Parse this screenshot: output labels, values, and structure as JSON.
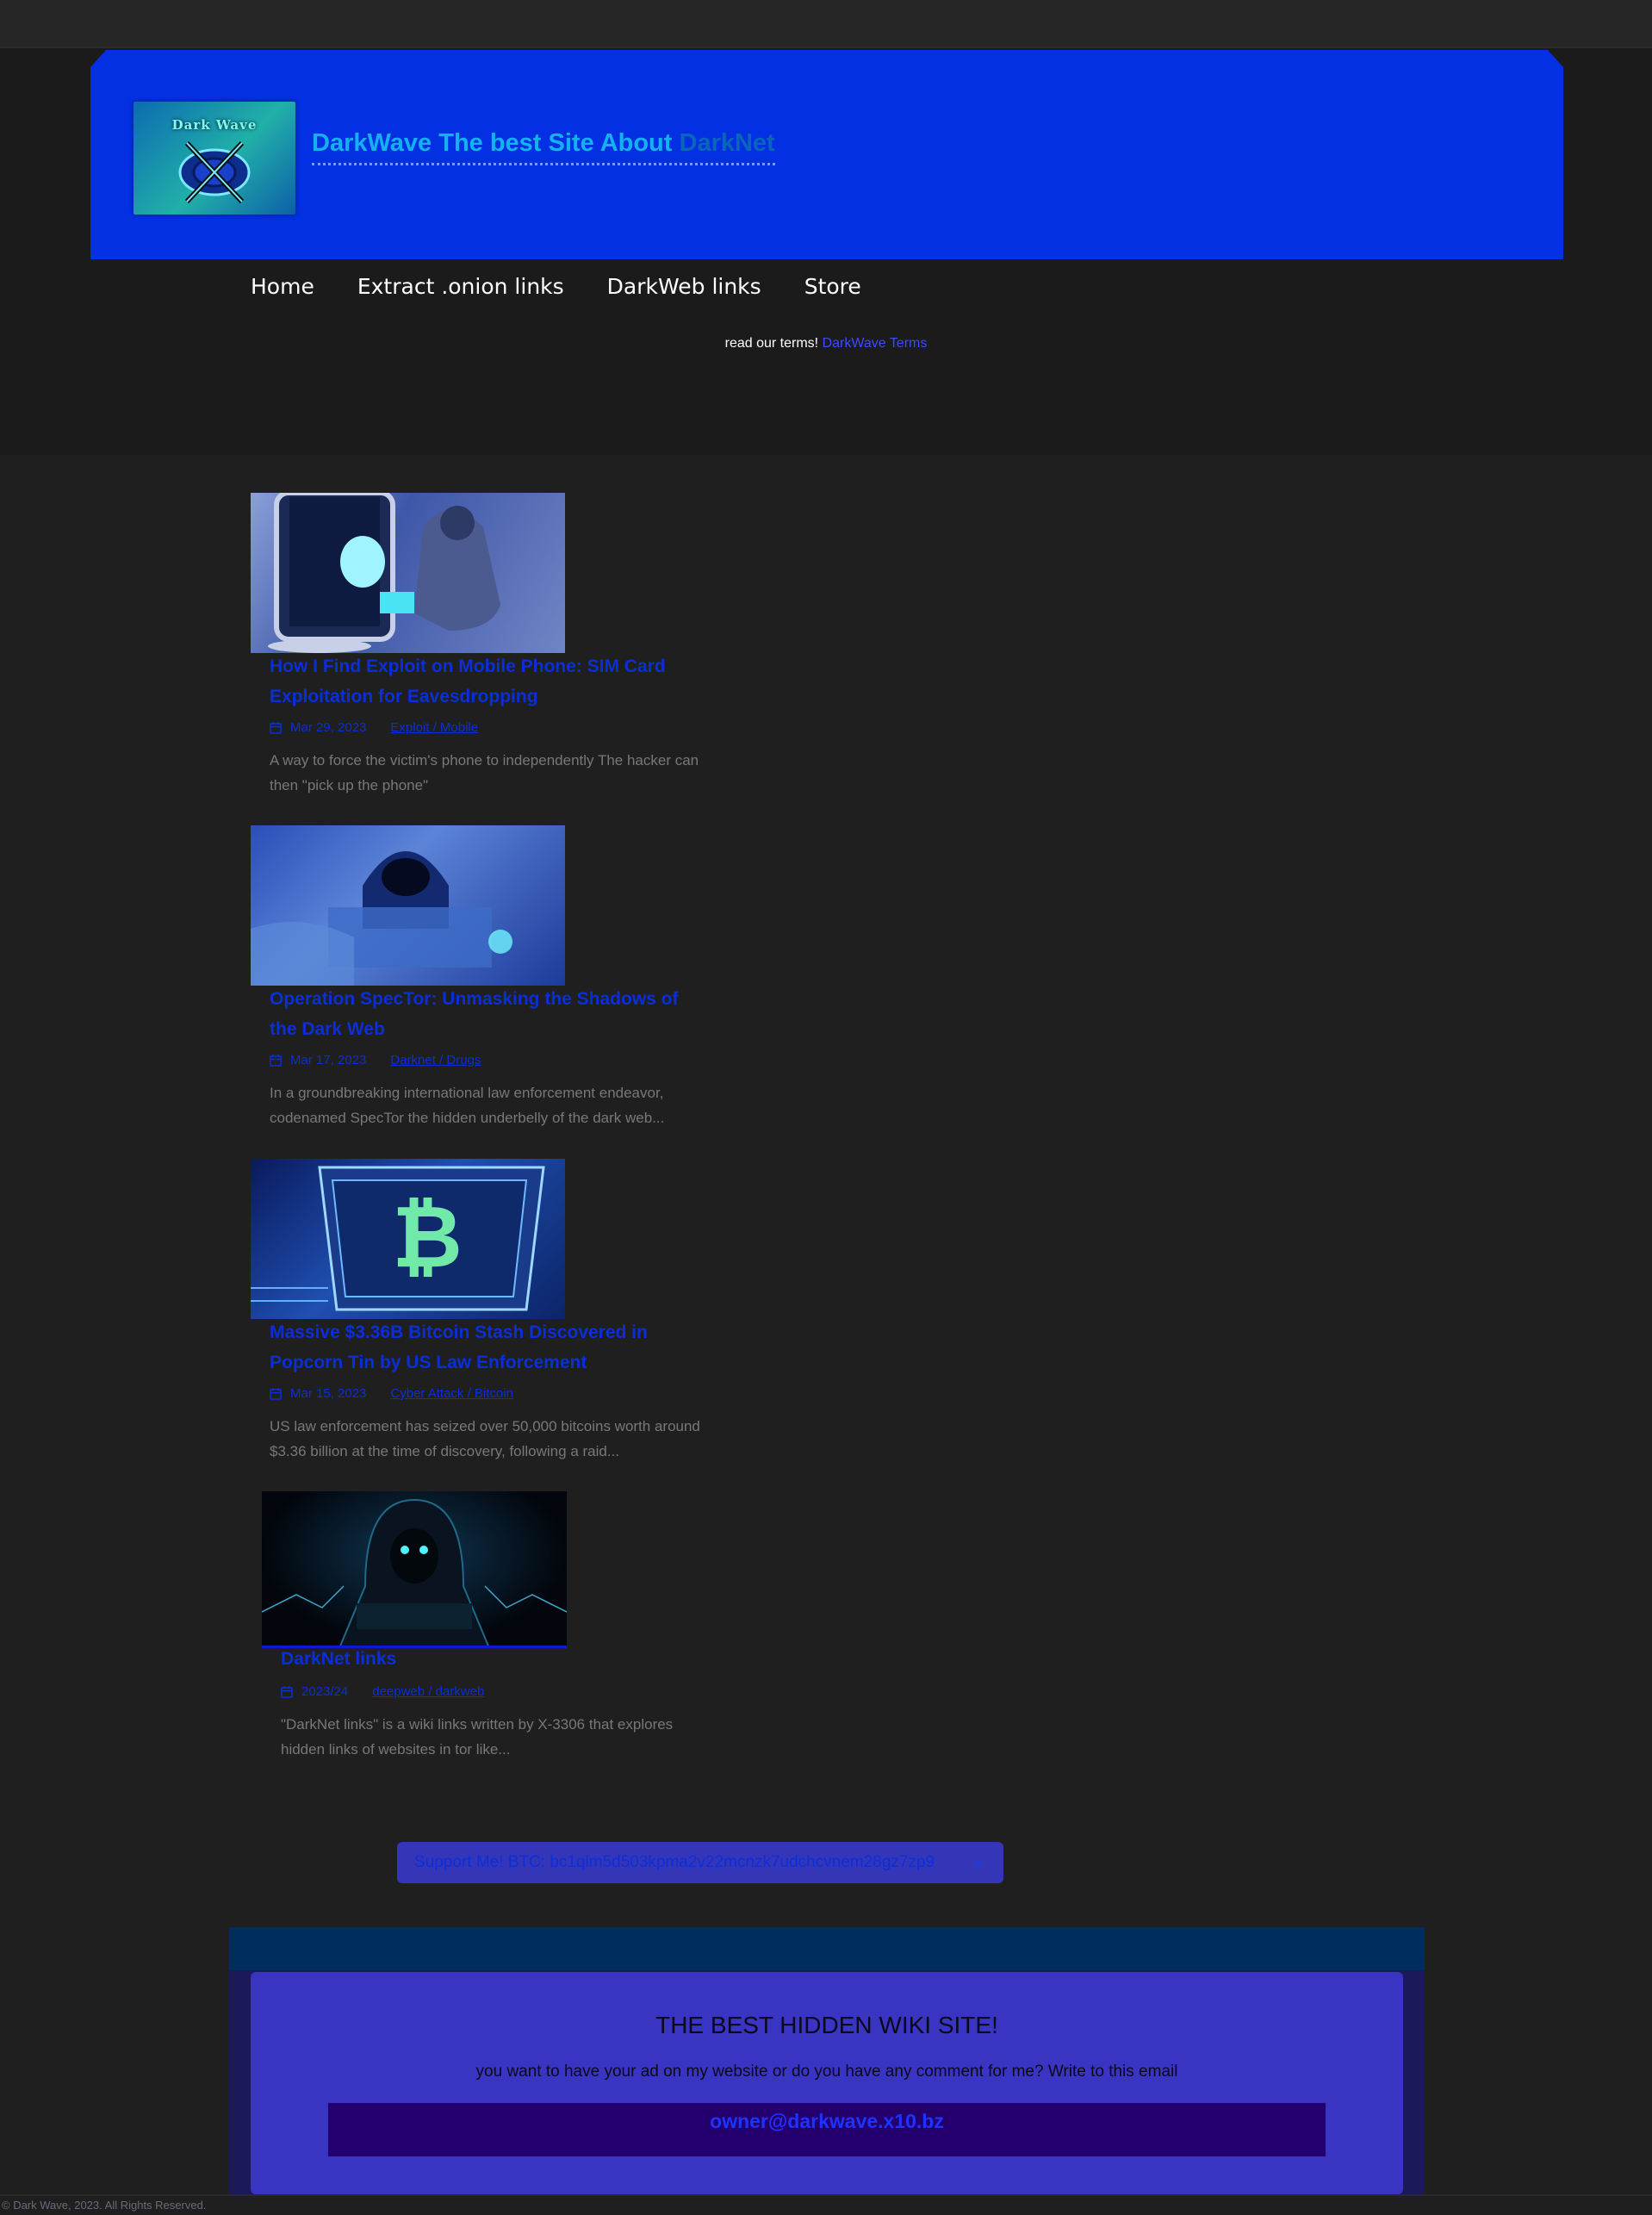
{
  "header": {
    "logo_text": "Dark Wave",
    "title_main": "DarkWave The best Site About ",
    "title_accent": "DarkNet"
  },
  "nav": {
    "items": [
      "Home",
      "Extract .onion links",
      "DarkWeb links",
      "Store"
    ]
  },
  "terms": {
    "prefix": "read our terms! ",
    "link": "DarkWave Terms"
  },
  "posts": [
    {
      "title": "How I Find Exploit on Mobile Phone: SIM Card Exploitation for Eavesdropping",
      "date": "Mar 29, 2023",
      "category": "Exploit / Mobile",
      "excerpt": "A way to force the victim's phone   to independently   The hacker can then \"pick up the phone\""
    },
    {
      "title": "Operation SpecTor: Unmasking the Shadows of the Dark Web",
      "date": "Mar 17, 2023",
      "category": "Darknet / Drugs",
      "excerpt": "In a groundbreaking international law enforcement endeavor, codenamed  SpecTor  the hidden underbelly of the dark web..."
    },
    {
      "title": "Massive $3.36B Bitcoin Stash Discovered in Popcorn Tin by US Law Enforcement",
      "date": "Mar 15, 2023",
      "category": "Cyber Attack / Bitcoin",
      "excerpt": "US law enforcement has seized over 50,000  bitcoins  worth around $3.36 billion at the time of discovery, following a raid..."
    },
    {
      "title": "DarkNet links",
      "date": "2023/24",
      "category": "deepweb / darkweb",
      "excerpt": "\"DarkNet links\" is a wiki links written by X-3306  that explores   hidden links of websites in tor  like..."
    }
  ],
  "support": {
    "label": "Support Me! BTC: bc1qlm5d503kpma2v22mcnzk7udchcvnem28gz7zp9",
    "chevron": "›"
  },
  "footer": {
    "title": "THE BEST HIDDEN WIKI SITE!",
    "text": "you want to have your ad on my website or do you have any comment for me? Write to this email",
    "email": "owner@darkwave.x10.bz",
    "copyright": "© Dark Wave, 2023. All Rights Reserved."
  },
  "colors": {
    "banner": "#0330e2",
    "accent": "#0a2fd9",
    "title_cyan": "#13b2f0",
    "background": "#1f1f1f"
  }
}
